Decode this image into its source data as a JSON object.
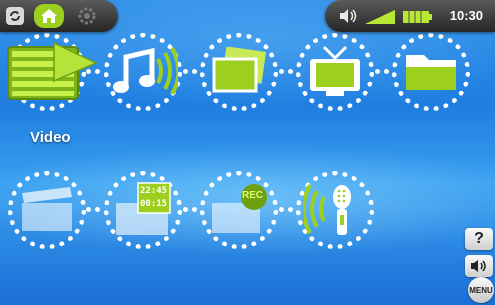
{
  "status_bar": {
    "time": "10:30",
    "volume_icon": "speaker-icon",
    "signal_icon": "signal-bars-icon",
    "battery_icon": "battery-icon"
  },
  "top_left": {
    "buttons": [
      {
        "name": "refresh-icon"
      },
      {
        "name": "home-icon"
      },
      {
        "name": "settings-gear-icon"
      }
    ]
  },
  "home_menu": {
    "selected_label": "Video",
    "items": [
      {
        "name": "video"
      },
      {
        "name": "music"
      },
      {
        "name": "photos"
      },
      {
        "name": "tv"
      },
      {
        "name": "files"
      },
      {
        "name": "clapperboard"
      },
      {
        "name": "tv-scheduler"
      },
      {
        "name": "recorder"
      },
      {
        "name": "sound-recorder"
      }
    ],
    "scheduler_times": [
      "22:45",
      "00:15"
    ],
    "rec_badge": "REC"
  },
  "side_buttons": {
    "help": "?",
    "menu": "MENU"
  },
  "colors": {
    "accent_green": "#9ccf1e",
    "background_blue": "#2a86e6"
  }
}
